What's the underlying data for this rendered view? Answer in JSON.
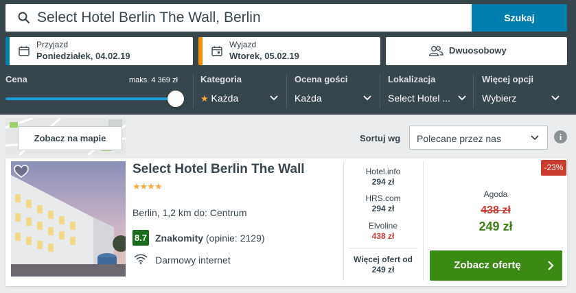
{
  "search": {
    "value": "Select Hotel Berlin The Wall, Berlin",
    "button_label": "Szukaj",
    "icon": "search-icon"
  },
  "dates": {
    "checkin_label": "Przyjazd",
    "checkin_value": "Poniedziałek, 04.02.19",
    "checkout_label": "Wyjazd",
    "checkout_value": "Wtorek, 05.02.19",
    "checkin_color": "#007faf",
    "checkout_color": "#f48f00"
  },
  "room": {
    "value": "Dwuosobowy",
    "icon": "guests-icon"
  },
  "filters": {
    "price_label": "Cena",
    "price_max": "maks. 4 369 zł",
    "price_fraction": 1.0,
    "category_label": "Kategoria",
    "category_value": "Każda",
    "category_icon": "★",
    "rating_label": "Ocena gości",
    "rating_value": "Każda",
    "location_label": "Lokalizacja",
    "location_value": "Select Hotel ...",
    "more_label": "Więcej opcji",
    "more_value": "Wybierz"
  },
  "results": {
    "map_button": "Zobacz na mapie",
    "sort_label": "Sortuj wg",
    "sort_value": "Polecane przez nas",
    "info_icon": "i"
  },
  "hotel": {
    "name": "Select Hotel Berlin The Wall",
    "stars": "★★★★",
    "location": "Berlin, 1,2 km do: Centrum",
    "rating_score": "8.7",
    "rating_word": "Znakomity",
    "rating_count": "(opinie: 2129)",
    "amenity": "Darmowy internet",
    "partners": [
      {
        "name": "Hotel.info",
        "price": "294 zł"
      },
      {
        "name": "HRS.com",
        "price": "294 zł"
      },
      {
        "name": "Elvoline",
        "price": "438 zł"
      }
    ],
    "more_offers_label": "Więcej ofert od",
    "more_offers_price": "249 zł",
    "discount": "-23%",
    "deal_partner": "Agoda",
    "old_price": "438 zł",
    "new_price": "249 zł",
    "cta_label": "Zobacz ofertę",
    "accent_green": "#3a8b13",
    "accent_red": "#cc3c2e"
  }
}
